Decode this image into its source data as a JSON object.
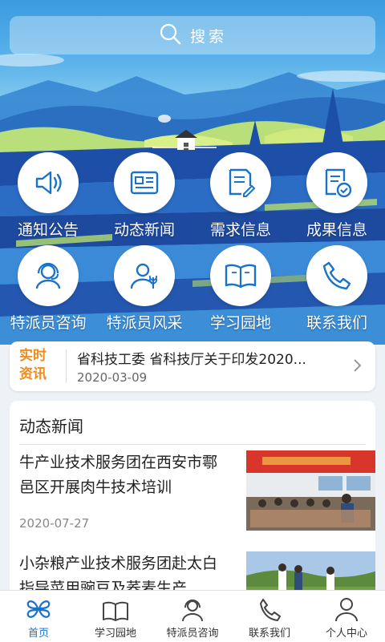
{
  "search": {
    "label": "搜索"
  },
  "grid": {
    "items": [
      {
        "label": "通知公告",
        "icon": "speaker-icon"
      },
      {
        "label": "动态新闻",
        "icon": "news-icon"
      },
      {
        "label": "需求信息",
        "icon": "edit-document-icon"
      },
      {
        "label": "成果信息",
        "icon": "result-document-icon"
      },
      {
        "label": "特派员咨询",
        "icon": "headset-person-icon"
      },
      {
        "label": "特派员风采",
        "icon": "person-wheat-icon"
      },
      {
        "label": "学习园地",
        "icon": "book-icon"
      },
      {
        "label": "联系我们",
        "icon": "phone-icon"
      }
    ]
  },
  "realtime": {
    "tag_line1": "实时",
    "tag_line2": "资讯",
    "title": "省科技工委 省科技厅关于印发2020...",
    "date": "2020-03-09"
  },
  "news": {
    "section_title": "动态新闻",
    "articles": [
      {
        "title": "牛产业技术服务团在西安市鄠邑区开展肉牛技术培训",
        "date": "2020-07-27"
      },
      {
        "title": "小杂粮产业技术服务团赴太白指导菜用豌豆及荞麦生产",
        "date": ""
      }
    ]
  },
  "tabbar": {
    "tabs": [
      {
        "label": "首页",
        "icon": "home-icon",
        "active": true
      },
      {
        "label": "学习园地",
        "icon": "book-icon"
      },
      {
        "label": "特派员咨询",
        "icon": "headset-person-icon"
      },
      {
        "label": "联系我们",
        "icon": "phone-icon"
      },
      {
        "label": "个人中心",
        "icon": "user-icon"
      }
    ]
  },
  "colors": {
    "primary": "#1a73c9",
    "accent_orange": "#f08a1a",
    "hero_blue": "#3c8fd6"
  }
}
